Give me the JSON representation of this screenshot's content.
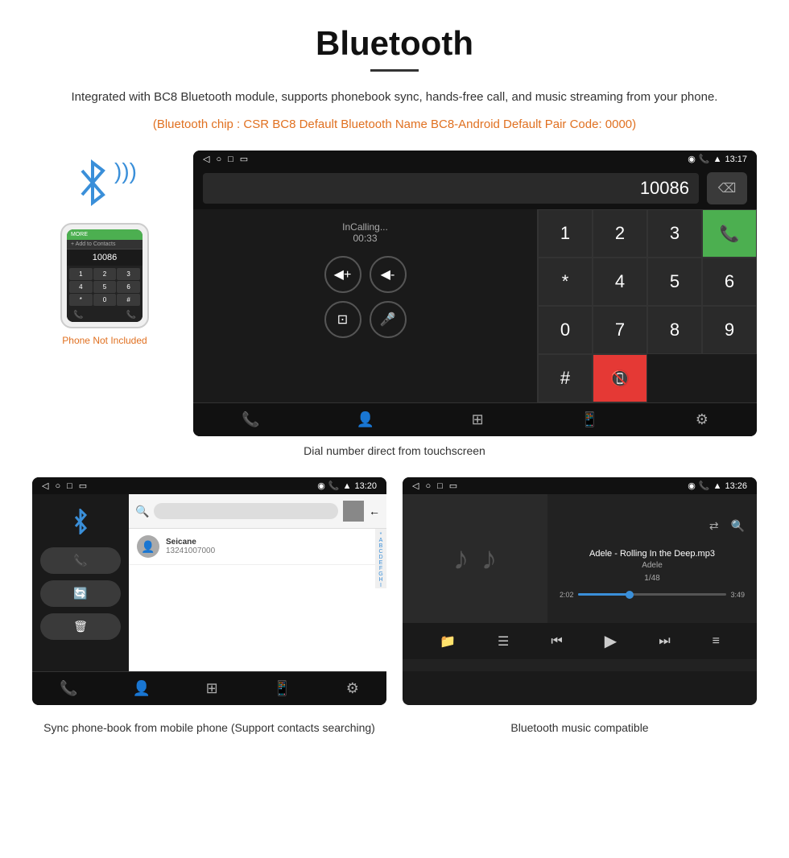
{
  "page": {
    "title": "Bluetooth",
    "underline": true,
    "description": "Integrated with BC8 Bluetooth module, supports phonebook sync, hands-free call, and music streaming from your phone.",
    "orange_note": "(Bluetooth chip : CSR BC8    Default Bluetooth Name BC8-Android    Default Pair Code: 0000)",
    "phone_label": "Phone Not Included",
    "caption_dial": "Dial number direct from touchscreen",
    "caption_contacts": "Sync phone-book from mobile phone\n(Support contacts searching)",
    "caption_music": "Bluetooth music compatible"
  },
  "dial_screen": {
    "status_left": [
      "◁",
      "○",
      "□",
      "▭"
    ],
    "status_right": "13:17",
    "dial_number": "10086",
    "in_calling": "InCalling...",
    "call_time": "00:33",
    "keys": [
      "1",
      "2",
      "3",
      "*",
      "4",
      "5",
      "6",
      "0",
      "7",
      "8",
      "9",
      "#"
    ]
  },
  "contacts_screen": {
    "status_right": "13:20",
    "contact_name": "Seicane",
    "contact_number": "13241007000",
    "alpha_letters": [
      "*",
      "A",
      "B",
      "C",
      "D",
      "E",
      "F",
      "G",
      "H",
      "I"
    ]
  },
  "music_screen": {
    "status_right": "13:26",
    "song_title": "Adele - Rolling In the Deep.mp3",
    "artist": "Adele",
    "track": "1/48",
    "time_start": "2:02",
    "time_end": "3:49",
    "progress_percent": 35
  },
  "icons": {
    "bluetooth": "✦",
    "back_nav": "◁",
    "home_nav": "○",
    "recent_nav": "□",
    "screenshot_nav": "▭",
    "volume_up": "◀+",
    "volume_down": "◀-",
    "transfer": "⊡",
    "mic": "🎤",
    "phone_call": "📞",
    "profile": "👤",
    "grid": "⊞",
    "device": "📱",
    "settings": "⚙",
    "search": "🔍",
    "music_note": "♪",
    "shuffle": "⇄",
    "prev": "⏮",
    "play": "▶",
    "next": "⏭",
    "eq": "≡",
    "folder": "📁",
    "list": "☰",
    "delete": "⌫"
  }
}
